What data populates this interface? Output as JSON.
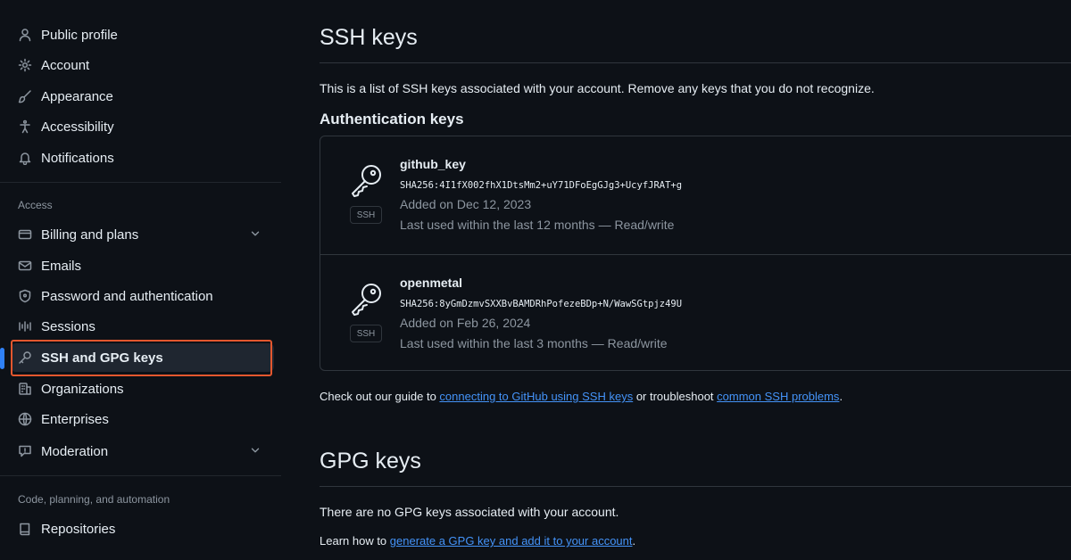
{
  "sidebar": {
    "top_items": [
      {
        "label": "Public profile",
        "icon": "person-icon"
      },
      {
        "label": "Account",
        "icon": "gear-icon"
      },
      {
        "label": "Appearance",
        "icon": "paintbrush-icon"
      },
      {
        "label": "Accessibility",
        "icon": "accessibility-icon"
      },
      {
        "label": "Notifications",
        "icon": "bell-icon"
      }
    ],
    "access_title": "Access",
    "access_items": [
      {
        "label": "Billing and plans",
        "icon": "credit-card-icon",
        "expandable": true
      },
      {
        "label": "Emails",
        "icon": "mail-icon"
      },
      {
        "label": "Password and authentication",
        "icon": "shield-lock-icon"
      },
      {
        "label": "Sessions",
        "icon": "broadcast-icon"
      },
      {
        "label": "SSH and GPG keys",
        "icon": "key-icon",
        "active": true
      },
      {
        "label": "Organizations",
        "icon": "organization-icon"
      },
      {
        "label": "Enterprises",
        "icon": "globe-icon"
      },
      {
        "label": "Moderation",
        "icon": "report-icon",
        "expandable": true
      }
    ],
    "code_title": "Code, planning, and automation",
    "code_items": [
      {
        "label": "Repositories",
        "icon": "repo-icon"
      }
    ]
  },
  "main": {
    "ssh_title": "SSH keys",
    "ssh_description": "This is a list of SSH keys associated with your account. Remove any keys that you do not recognize.",
    "auth_keys_title": "Authentication keys",
    "keys": [
      {
        "title": "github_key",
        "fingerprint": "SHA256:4I1fX002fhX1DtsMm2+uY71DFoEgGJg3+UcyfJRAT+g",
        "added": "Added on Dec 12, 2023",
        "last_used": "Last used within the last 12 months — Read/write",
        "badge": "SSH"
      },
      {
        "title": "openmetal",
        "fingerprint": "SHA256:8yGmDzmvSXXBvBAMDRhPofezeBDp+N/WawSGtpjz49U",
        "added": "Added on Feb 26, 2024",
        "last_used": "Last used within the last 3 months — Read/write",
        "badge": "SSH"
      }
    ],
    "guide_prefix": "Check out our guide to ",
    "guide_link1": "connecting to GitHub using SSH keys",
    "guide_middle": " or troubleshoot ",
    "guide_link2": "common SSH problems",
    "guide_suffix": ".",
    "gpg_title": "GPG keys",
    "gpg_description": "There are no GPG keys associated with your account.",
    "gpg_learn_prefix": "Learn how to ",
    "gpg_learn_link": "generate a GPG key and add it to your account",
    "gpg_learn_suffix": "."
  },
  "colors": {
    "background": "#0d1117",
    "highlight": "#e4572e",
    "link": "#4493f8",
    "active_indicator": "#2f81f7"
  }
}
